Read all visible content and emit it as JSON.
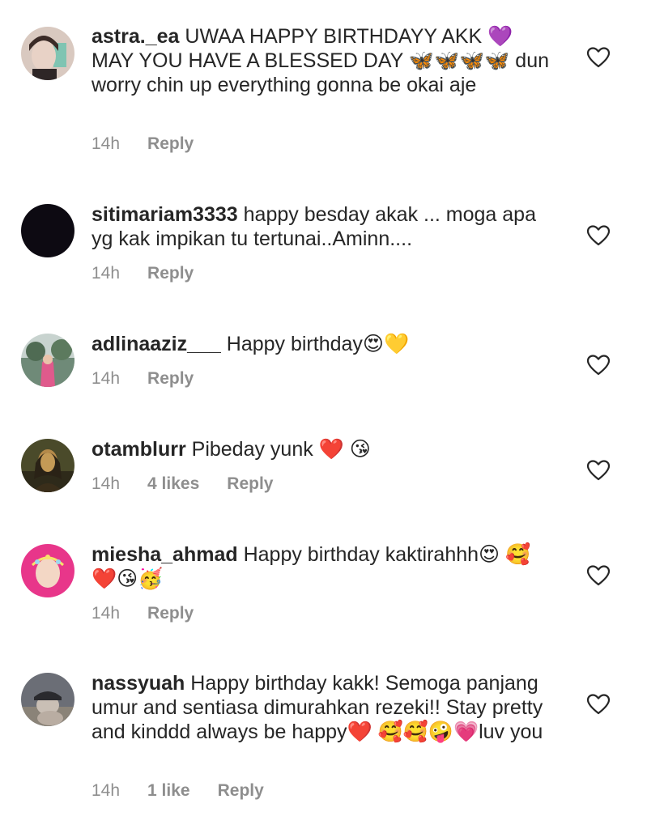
{
  "comments": [
    {
      "username": "astra._ea",
      "text": "UWAA HAPPY BIRTHDAYY AKK 💜 MAY YOU HAVE A BLESSED DAY 🦋🦋🦋🦋 dun worry chin up everything gonna be okai aje",
      "time": "14h",
      "likes": "",
      "reply": "Reply",
      "avatar_colors": [
        "#d9c9c0",
        "#3b2b27"
      ]
    },
    {
      "username": "sitimariam3333",
      "text": "happy besday akak ... moga apa yg kak impikan tu tertunai..Aminn....",
      "time": "14h",
      "likes": "",
      "reply": "Reply",
      "avatar_colors": [
        "#0d0a12",
        "#0d0a12"
      ]
    },
    {
      "username": "adlinaaziz___",
      "text": "Happy birthday😍💛",
      "time": "14h",
      "likes": "",
      "reply": "Reply",
      "avatar_colors": [
        "#6f8a78",
        "#e05a8c"
      ]
    },
    {
      "username": "otamblurr",
      "text": "Pibeday yunk ❤️ 😘",
      "time": "14h",
      "likes": "4 likes",
      "reply": "Reply",
      "avatar_colors": [
        "#3a3a22",
        "#b58a4a"
      ]
    },
    {
      "username": "miesha_ahmad",
      "text": "Happy birthday kaktirahhh😍 🥰❤️😘🥳",
      "time": "14h",
      "likes": "",
      "reply": "Reply",
      "avatar_colors": [
        "#e8368a",
        "#f3d7c5"
      ]
    },
    {
      "username": "nassyuah",
      "text": "Happy birthday kakk! Semoga panjang umur and sentiasa dimurahkan rezeki!! Stay pretty and kinddd always be happy❤️ 🥰🥰🤪💗luv you",
      "time": "14h",
      "likes": "1 like",
      "reply": "Reply",
      "avatar_colors": [
        "#6b6e76",
        "#c9bfb5"
      ]
    }
  ]
}
